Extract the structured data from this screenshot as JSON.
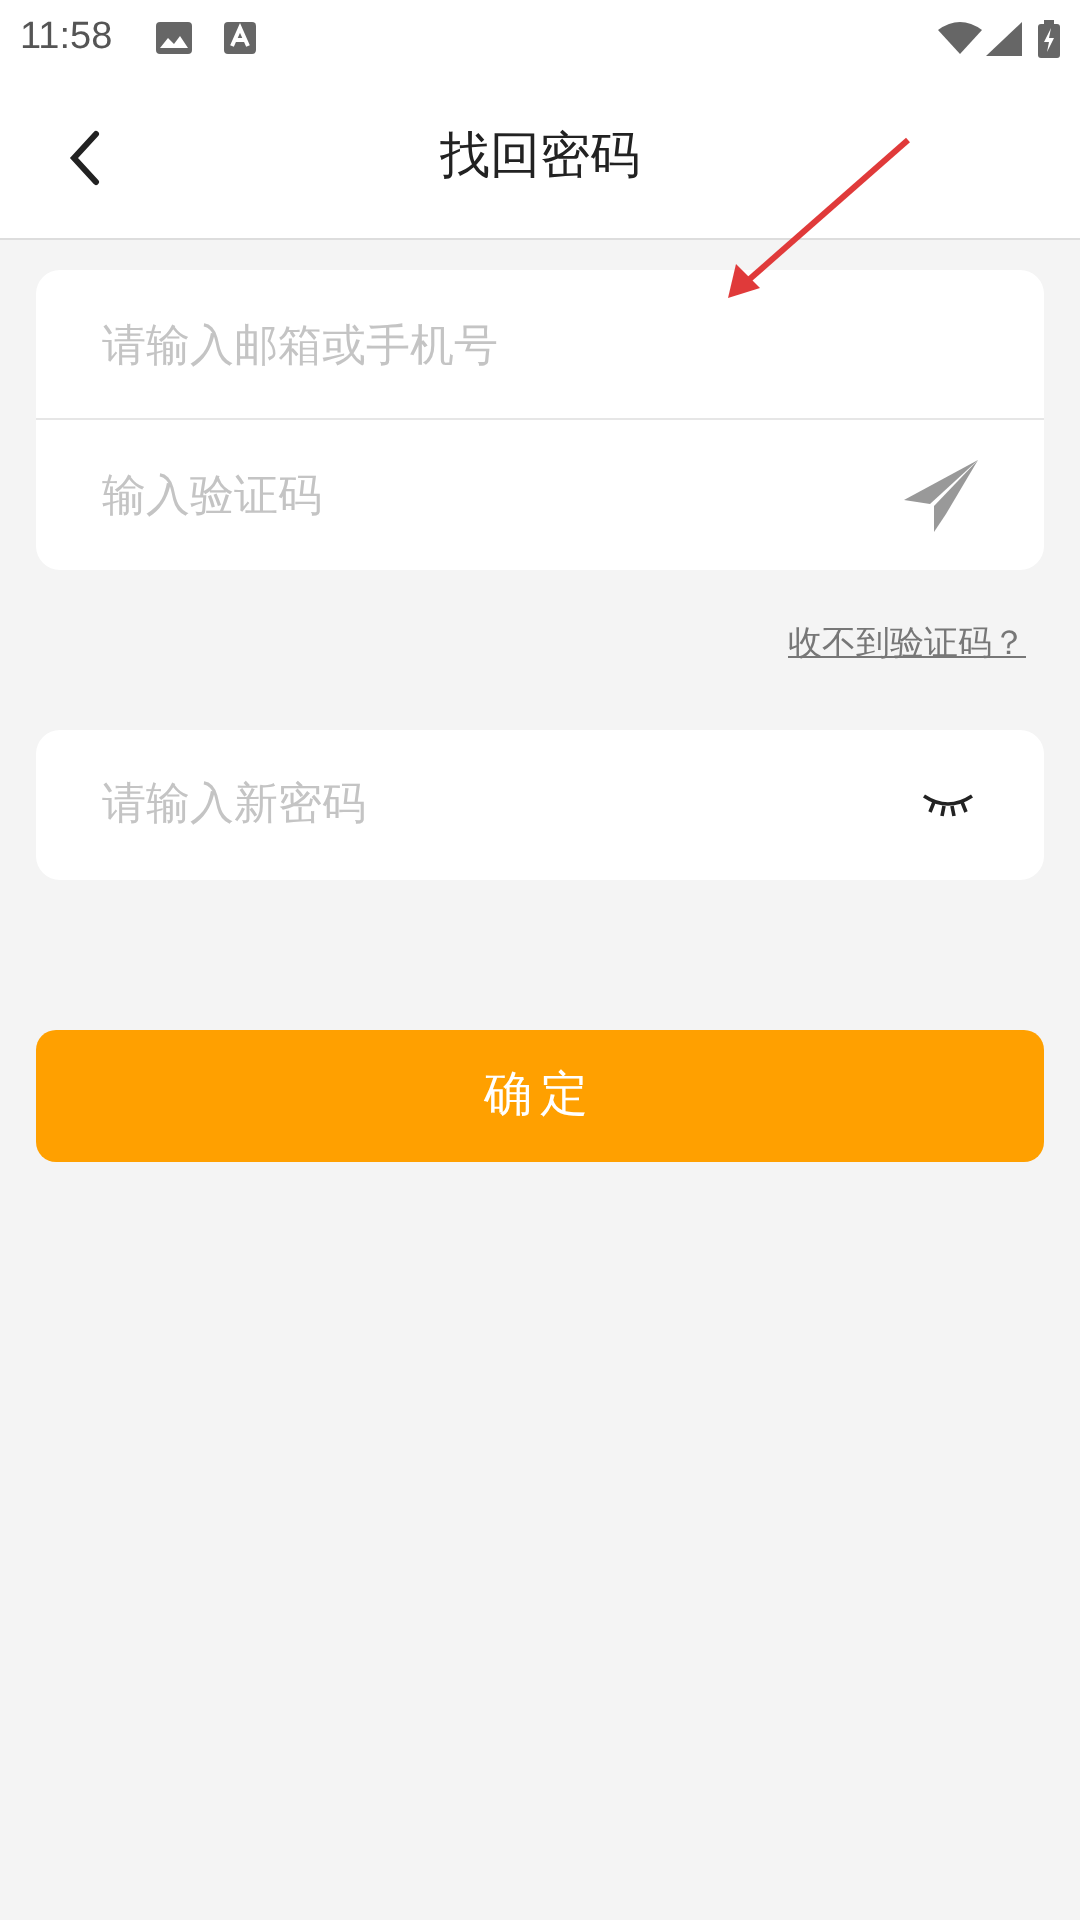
{
  "status_bar": {
    "time": "11:58"
  },
  "header": {
    "title": "找回密码"
  },
  "account_field": {
    "placeholder": "请输入邮箱或手机号"
  },
  "code_field": {
    "placeholder": "输入验证码"
  },
  "no_code_link": "收不到验证码？",
  "password_field": {
    "placeholder": "请输入新密码",
    "visible": false
  },
  "confirm_button": "确定"
}
